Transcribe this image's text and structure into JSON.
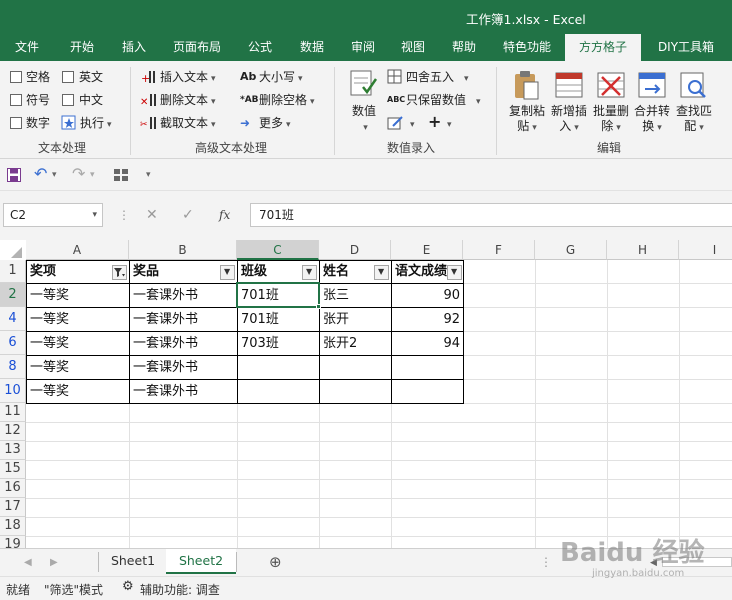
{
  "window": {
    "title": "工作簿1.xlsx  -  Excel"
  },
  "menu_tabs": [
    "文件",
    "开始",
    "插入",
    "页面布局",
    "公式",
    "数据",
    "审阅",
    "视图",
    "帮助",
    "特色功能",
    "方方格子",
    "DIY工具箱"
  ],
  "active_menu_tab": "方方格子",
  "ribbon": {
    "text_group": {
      "label": "文本处理",
      "items": [
        "空格",
        "英文",
        "符号",
        "中文",
        "数字",
        "执行"
      ]
    },
    "adv_group": {
      "label": "高级文本处理",
      "items": [
        "插入文本",
        "删除文本",
        "截取文本",
        "大小写",
        "删除空格",
        "更多"
      ]
    },
    "num_group": {
      "label": "数值录入",
      "items": [
        "数值",
        "四舍五入",
        "只保留数值"
      ]
    },
    "edit_group": {
      "label": "编辑",
      "items": [
        [
          "复制粘",
          "贴"
        ],
        [
          "新增插",
          "入"
        ],
        [
          "批量删",
          "除"
        ],
        [
          "合并转",
          "换"
        ],
        [
          "查找匹",
          "配"
        ]
      ]
    }
  },
  "name_box": "C2",
  "formula_bar": {
    "fx": "fx",
    "value": "701班"
  },
  "columns": [
    "A",
    "B",
    "C",
    "D",
    "E",
    "F",
    "G",
    "H",
    "I"
  ],
  "rows": [
    "1",
    "2",
    "4",
    "6",
    "8",
    "10",
    "11",
    "12",
    "13",
    "15",
    "16",
    "17",
    "18",
    "19"
  ],
  "headers": [
    "奖项",
    "奖品",
    "班级",
    "姓名",
    "语文成绩"
  ],
  "table": [
    [
      "一等奖",
      "一套课外书",
      "701班",
      "张三",
      "90"
    ],
    [
      "一等奖",
      "一套课外书",
      "701班",
      "张开",
      "92"
    ],
    [
      "一等奖",
      "一套课外书",
      "703班",
      "张开2",
      "94"
    ],
    [
      "一等奖",
      "一套课外书",
      "",
      "",
      ""
    ],
    [
      "一等奖",
      "一套课外书",
      "",
      "",
      ""
    ]
  ],
  "sheets": [
    "Sheet1",
    "Sheet2"
  ],
  "active_sheet": "Sheet2",
  "status": [
    "就绪",
    "\"筛选\"模式",
    "辅助功能: 调查"
  ],
  "watermark": [
    "Baidu 经验",
    "jingyan.baidu.com"
  ],
  "colors": {
    "excel_green": "#217346",
    "filtered_row_number": "#1a4fd6"
  }
}
